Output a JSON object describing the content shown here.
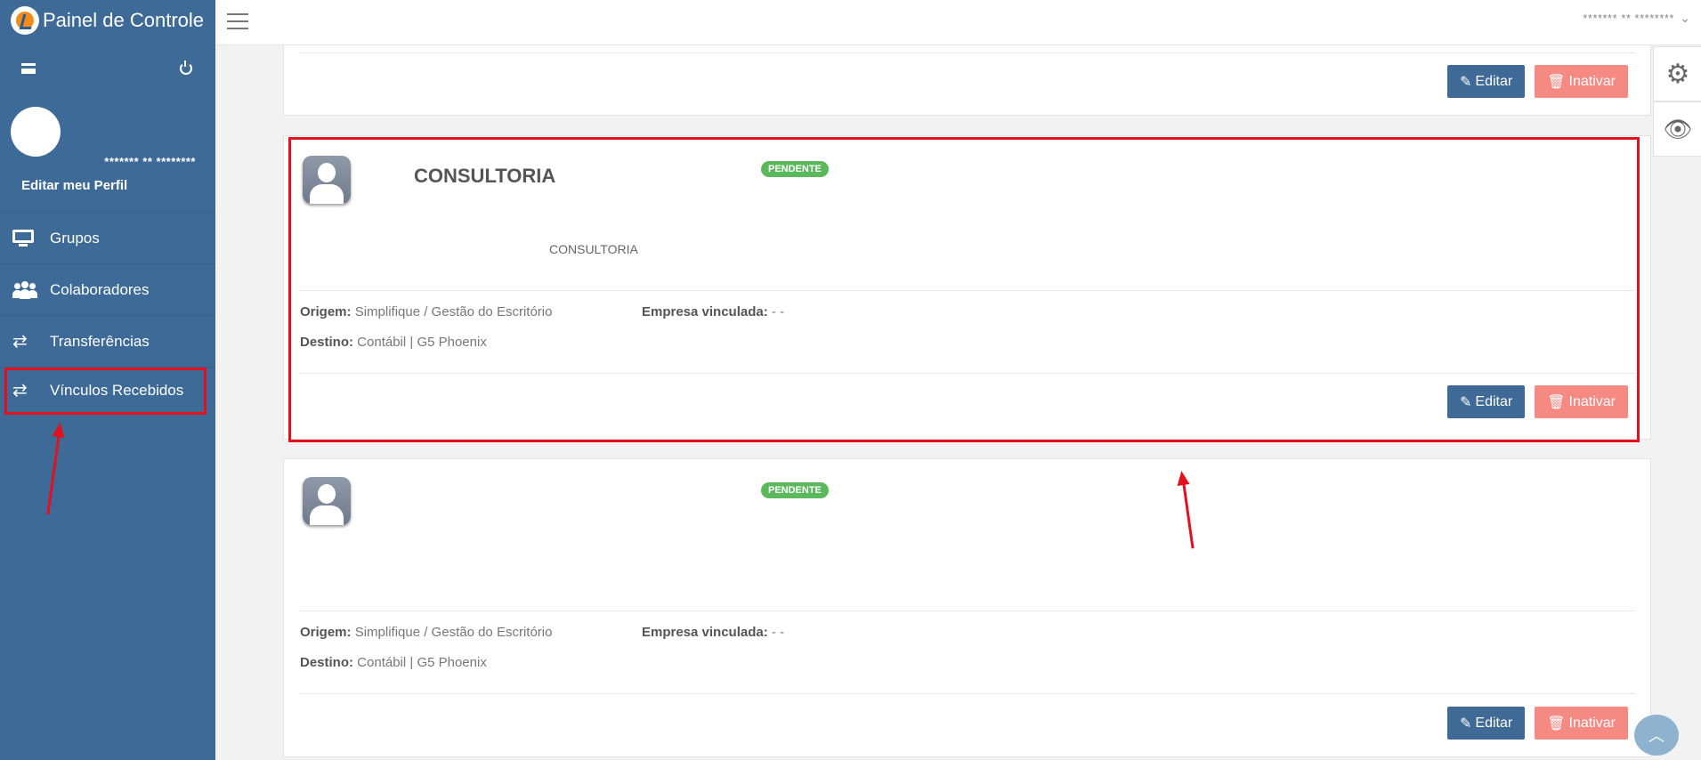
{
  "app": {
    "brand_title": "Painel de Controle"
  },
  "profile": {
    "name": "******* ** ********",
    "edit_link": "Editar meu Perfil"
  },
  "nav": [
    {
      "label": "Grupos",
      "icon": "monitor-icon"
    },
    {
      "label": "Colaboradores",
      "icon": "users-icon"
    },
    {
      "label": "Transferências",
      "icon": "transfer-icon"
    },
    {
      "label": "Vínculos Recebidos",
      "icon": "transfer-icon"
    }
  ],
  "topbar": {
    "user": "******* ** ********"
  },
  "buttons": {
    "edit": "Editar",
    "inactivate": "Inativar"
  },
  "cards": [
    {
      "title": "CONSULTORIA",
      "status": "PENDENTE",
      "description": "CONSULTORIA",
      "origem_label": "Origem:",
      "origem": "Simplifique / Gestão do Escritório",
      "destino_label": "Destino:",
      "destino": "Contábil | G5 Phoenix",
      "empresa_label": "Empresa vinculada:",
      "empresa": "- -"
    },
    {
      "title": "",
      "status": "PENDENTE",
      "description": "",
      "origem_label": "Origem:",
      "origem": "Simplifique / Gestão do Escritório",
      "destino_label": "Destino:",
      "destino": "Contábil | G5 Phoenix",
      "empresa_label": "Empresa vinculada:",
      "empresa": "- -"
    }
  ],
  "colors": {
    "sidebar": "#3d6a96",
    "edit_button": "#3f6a96",
    "inactivate_button": "#f48a82",
    "badge": "#5cb85c",
    "annotation": "#e3101e"
  }
}
